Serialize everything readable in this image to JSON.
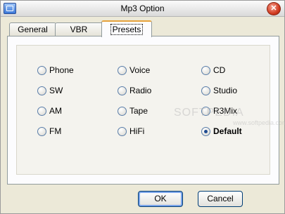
{
  "window": {
    "title": "Mp3 Option",
    "close_glyph": "✕"
  },
  "tabs": [
    {
      "label": "General"
    },
    {
      "label": "VBR"
    },
    {
      "label": "Presets",
      "active": true
    }
  ],
  "presets": {
    "col1": [
      "Phone",
      "SW",
      "AM",
      "FM"
    ],
    "col2": [
      "Voice",
      "Radio",
      "Tape",
      "HiFi"
    ],
    "col3": [
      "CD",
      "Studio",
      "R3Mix",
      "Default"
    ],
    "selected": "Default"
  },
  "buttons": {
    "ok": "OK",
    "cancel": "Cancel"
  },
  "watermark": {
    "brand": "SOFTPEDIA",
    "domain": "www.softpedia.com"
  },
  "colors": {
    "accent": "#e6a23c",
    "selected_dot": "#1f4b91"
  }
}
